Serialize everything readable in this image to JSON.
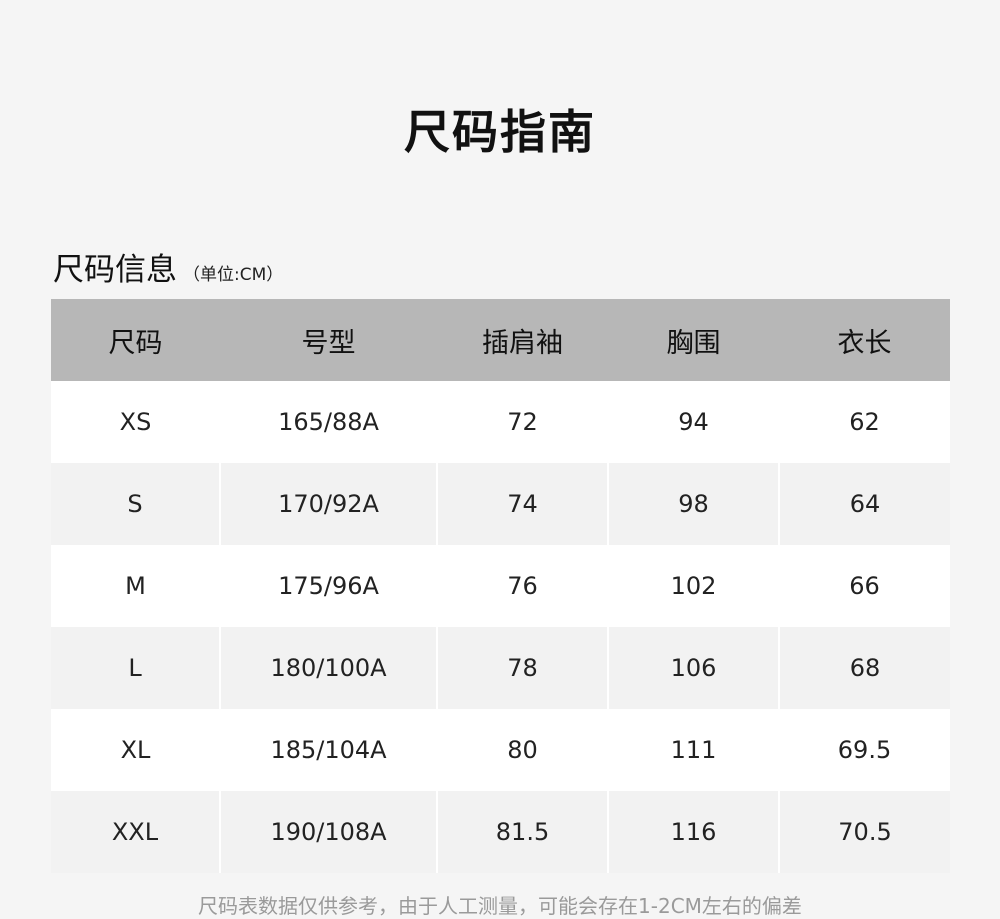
{
  "title": "尺码指南",
  "section": {
    "label": "尺码信息",
    "unit": "（单位:CM）"
  },
  "table": {
    "headers": [
      "尺码",
      "号型",
      "插肩袖",
      "胸围",
      "衣长"
    ],
    "rows": [
      [
        "XS",
        "165/88A",
        "72",
        "94",
        "62"
      ],
      [
        "S",
        "170/92A",
        "74",
        "98",
        "64"
      ],
      [
        "M",
        "175/96A",
        "76",
        "102",
        "66"
      ],
      [
        "L",
        "180/100A",
        "78",
        "106",
        "68"
      ],
      [
        "XL",
        "185/104A",
        "80",
        "111",
        "69.5"
      ],
      [
        "XXL",
        "190/108A",
        "81.5",
        "116",
        "70.5"
      ]
    ]
  },
  "note": "尺码表数据仅供参考，由于人工测量，可能会存在1-2CM左右的偏差",
  "colors": {
    "background": "#f5f5f5",
    "header_bg": "#b7b7b7",
    "row_light": "#ffffff",
    "row_gray": "#f2f2f2",
    "note": "#9a9a9a"
  }
}
